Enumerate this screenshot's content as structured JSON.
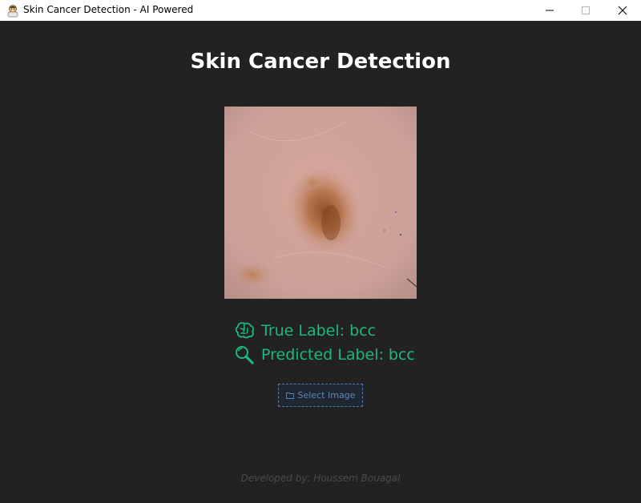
{
  "window": {
    "title": "Skin Cancer Detection - AI Powered",
    "icon": "doctor-emoji-icon",
    "controls": [
      "minimize-icon",
      "maximize-icon",
      "close-icon"
    ]
  },
  "app": {
    "heading": "Skin Cancer Detection",
    "image_icon": "skin-lesion-image",
    "true_label": {
      "icon": "brain-icon",
      "text": "True Label: bcc"
    },
    "predicted_label": {
      "icon": "magnifier-icon",
      "text": "Predicted Label: bcc"
    },
    "select_button": {
      "icon": "folder-icon",
      "label": "Select Image"
    },
    "footer": "Developed by: Houssem Bouagal"
  },
  "colors": {
    "background": "#222222",
    "accent": "#1db87a",
    "button_text": "#5b86b8",
    "footer_text": "#4a4a4a"
  }
}
